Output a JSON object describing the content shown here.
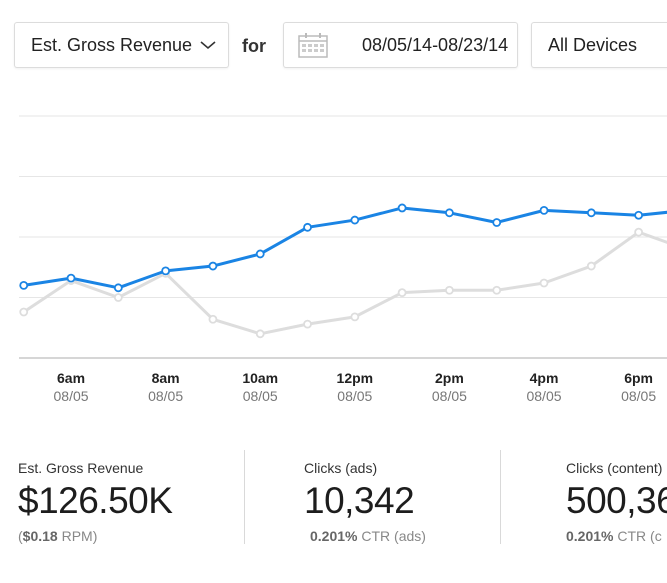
{
  "toolbar": {
    "metric_select": {
      "value": "Est. Gross Revenue",
      "icon": "chevron-down-icon"
    },
    "for_label": "for",
    "date_range": {
      "value": "08/05/14-08/23/14",
      "icon": "calendar-icon"
    },
    "device_select": {
      "value": "All Devices"
    }
  },
  "chart_data": {
    "type": "line",
    "x_ticks": [
      {
        "time": "6am",
        "date": "08/05"
      },
      {
        "time": "8am",
        "date": "08/05"
      },
      {
        "time": "10am",
        "date": "08/05"
      },
      {
        "time": "12pm",
        "date": "08/05"
      },
      {
        "time": "2pm",
        "date": "08/05"
      },
      {
        "time": "4pm",
        "date": "08/05"
      },
      {
        "time": "6pm",
        "date": "08/05"
      }
    ],
    "grid": true,
    "y_lines": 5,
    "ylim": [
      0,
      100
    ],
    "x_hours_range": [
      4.9,
      18.6
    ],
    "series": [
      {
        "color": "#1a84e4",
        "hours": [
          5,
          6,
          7,
          8,
          9,
          10,
          11,
          12,
          13,
          14,
          15,
          16,
          17,
          18,
          19
        ],
        "values": [
          30,
          33,
          29,
          36,
          38,
          43,
          54,
          57,
          62,
          60,
          56,
          61,
          60,
          59,
          61
        ]
      },
      {
        "color": "#dddddd",
        "hours": [
          5,
          6,
          7,
          8,
          9,
          10,
          11,
          12,
          13,
          14,
          15,
          16,
          17,
          18,
          19
        ],
        "values": [
          19,
          32,
          25,
          35,
          16,
          10,
          14,
          17,
          27,
          28,
          28,
          31,
          38,
          52,
          45
        ]
      }
    ]
  },
  "stats": [
    {
      "label": "Est. Gross Revenue",
      "value": "$126.50K",
      "sub_prefix": "(",
      "sub_bold": "$0.18",
      "sub_rest": " RPM)"
    },
    {
      "label": "Clicks (ads)",
      "value": "10,342",
      "sub_prefix": "",
      "sub_bold": "0.201%",
      "sub_rest": " CTR (ads)"
    },
    {
      "label": "Clicks (content)",
      "value": "500,36",
      "sub_prefix": "",
      "sub_bold": "0.201%",
      "sub_rest": " CTR (c"
    }
  ]
}
